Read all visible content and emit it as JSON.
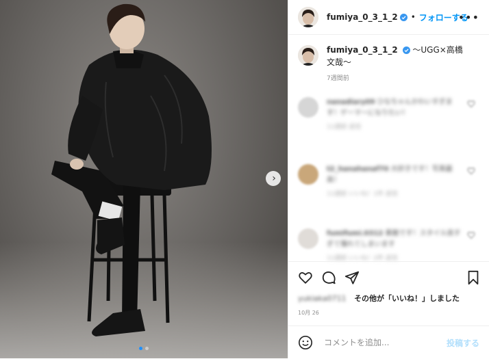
{
  "post": {
    "username": "fumiya_0_3_1_2",
    "follow_label": "フォローする",
    "separator": "•",
    "more_label": "•••"
  },
  "caption": {
    "username": "fumiya_0_3_1_2",
    "text": "〜UGG×高橋文哉〜",
    "time": "7週間前"
  },
  "comments": [
    {
      "user": "nanadiary09",
      "text": "ひなちゃんかわいすぎます！ゲーマーになりたい！",
      "meta": "11週前  返信"
    },
    {
      "user": "t2_hanahanaf70",
      "text": "大好きです！写真最高！",
      "meta": "11週前  いいね！1件  返信"
    },
    {
      "user": "fumifumi.0312",
      "text": "素敵です！スタイル良すぎて憧れてしまいます",
      "meta": "11週前  いいね！2件  返信"
    }
  ],
  "likes": {
    "blurred_name": "yukiaka0711",
    "label": "その他が「いいね！」しました"
  },
  "date": "10月 26",
  "add_comment": {
    "placeholder": "コメントを追加...",
    "post_label": "投稿する"
  },
  "colors": {
    "accent": "#0095f6",
    "post_disabled": "#b2dffc",
    "carousel_active": "#1e90ff"
  },
  "icons": [
    "verified-badge-icon",
    "more-icon",
    "heart-icon",
    "comment-icon",
    "share-icon",
    "bookmark-icon",
    "emoji-icon",
    "chevron-right-icon"
  ],
  "carousel": {
    "slides": 2,
    "active_index": 0
  }
}
